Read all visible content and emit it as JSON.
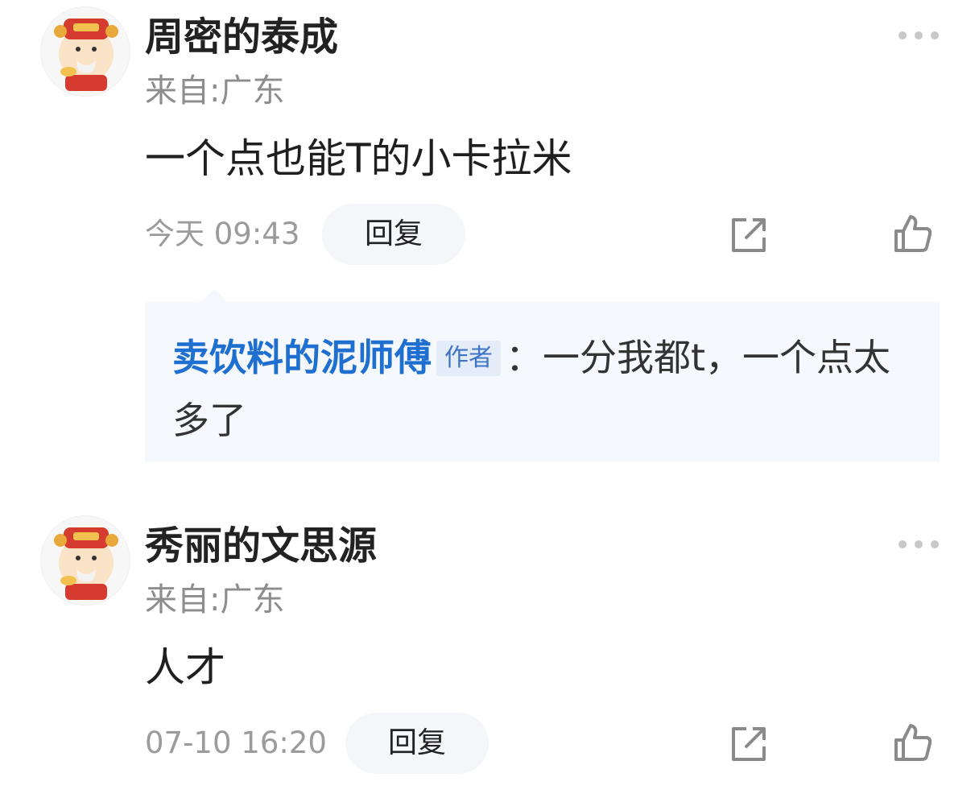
{
  "comments": [
    {
      "username": "周密的泰成",
      "location": "来自:广东",
      "content": "一个点也能T的小卡拉米",
      "time": "今天 09:43",
      "reply_label": "回复",
      "replies": [
        {
          "author": "卖饮料的泥师傅",
          "author_tag": "作者",
          "separator": "：",
          "text": "一分我都t，一个点太多了"
        }
      ]
    },
    {
      "username": "秀丽的文思源",
      "location": "来自:广东",
      "content": "人才",
      "time": "07-10 16:20",
      "reply_label": "回复"
    }
  ],
  "icons": {
    "more": "more-horizontal-icon",
    "share": "share-external-icon",
    "like": "thumbs-up-icon"
  },
  "colors": {
    "author_link": "#1f6fd0",
    "reply_bg": "#f5f8fc",
    "reply_button_bg": "#f4f6fa",
    "meta_text": "#9b9b9b"
  }
}
